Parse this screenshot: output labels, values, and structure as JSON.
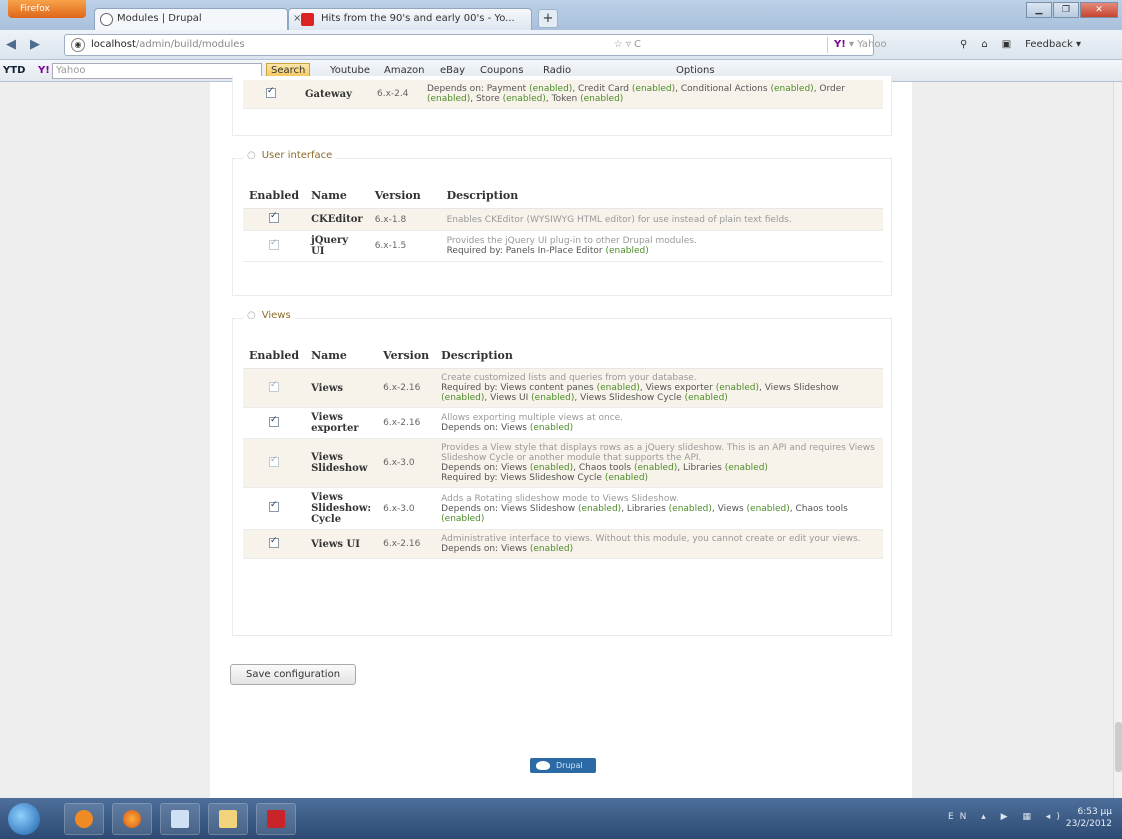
{
  "browser": {
    "app_button": "Firefox",
    "tabs": [
      {
        "label": "Modules | Drupal",
        "close": ""
      },
      {
        "label": "Hits from the 90's and early 00's - Yo...",
        "close": "×"
      }
    ],
    "new_tab": "+",
    "url_host": "localhost",
    "url_path": "/admin/build/modules",
    "url_controls": "☆ ▿ C",
    "search_engine_placeholder": "Yahoo",
    "feedback_label": "Feedback ▾"
  },
  "toolbar": {
    "ytd": "YTD",
    "yahoo_placeholder": "Yahoo",
    "search_btn": "Search",
    "items": [
      "Youtube",
      "Amazon",
      "eBay",
      "Coupons",
      "Radio",
      "Options"
    ]
  },
  "partial_row": {
    "name": "Gateway",
    "version": "6.x-2.4",
    "depends_prefix": "Depends on: Payment ",
    "depends_rest": ", Credit Card (enabled), Conditional Actions (enabled), Order (enabled), Store (enabled), Token (enabled)",
    "enabled": "(enabled)"
  },
  "ui_fieldset": {
    "legend": "User interface",
    "headers": {
      "enabled": "Enabled",
      "name": "Name",
      "version": "Version",
      "description": "Description"
    },
    "rows": [
      {
        "name": "CKEditor",
        "version": "6.x-1.8",
        "desc": "Enables CKEditor (WYSIWYG HTML editor) for use instead of plain text fields.",
        "dep": ""
      },
      {
        "name": "jQuery UI",
        "version": "6.x-1.5",
        "desc": "Provides the jQuery UI plug-in to other Drupal modules.",
        "dep": "Required by: Panels In-Place Editor (enabled)"
      }
    ]
  },
  "views_fieldset": {
    "legend": "Views",
    "headers": {
      "enabled": "Enabled",
      "name": "Name",
      "version": "Version",
      "description": "Description"
    },
    "rows": [
      {
        "name": "Views",
        "version": "6.x-2.16",
        "desc": "Create customized lists and queries from your database.",
        "dep": "Required by: Views content panes (enabled), Views exporter (enabled), Views Slideshow (enabled), Views UI (enabled), Views Slideshow Cycle (enabled)"
      },
      {
        "name": "Views exporter",
        "version": "6.x-2.16",
        "desc": "Allows exporting multiple views at once.",
        "dep": "Depends on: Views (enabled)"
      },
      {
        "name": "Views Slideshow",
        "version": "6.x-3.0",
        "desc": "Provides a View style that displays rows as a jQuery slideshow. This is an API and requires Views Slideshow Cycle or another module that supports the API.",
        "dep": "Depends on: Views (enabled), Chaos tools (enabled), Libraries (enabled)",
        "dep2": "Required by: Views Slideshow Cycle (enabled)"
      },
      {
        "name": "Views Slideshow: Cycle",
        "version": "6.x-3.0",
        "desc": "Adds a Rotating slideshow mode to Views Slideshow.",
        "dep": "Depends on: Views Slideshow (enabled), Libraries (enabled), Views (enabled), Chaos tools (enabled)"
      },
      {
        "name": "Views UI",
        "version": "6.x-2.16",
        "desc": "Administrative interface to views. Without this module, you cannot create or edit your views.",
        "dep": "Depends on: Views (enabled)"
      }
    ]
  },
  "save_button": "Save configuration",
  "footer_badge": "Drupal",
  "taskbar": {
    "lang": "EN",
    "time": "6:53 μμ",
    "date": "23/2/2012"
  }
}
